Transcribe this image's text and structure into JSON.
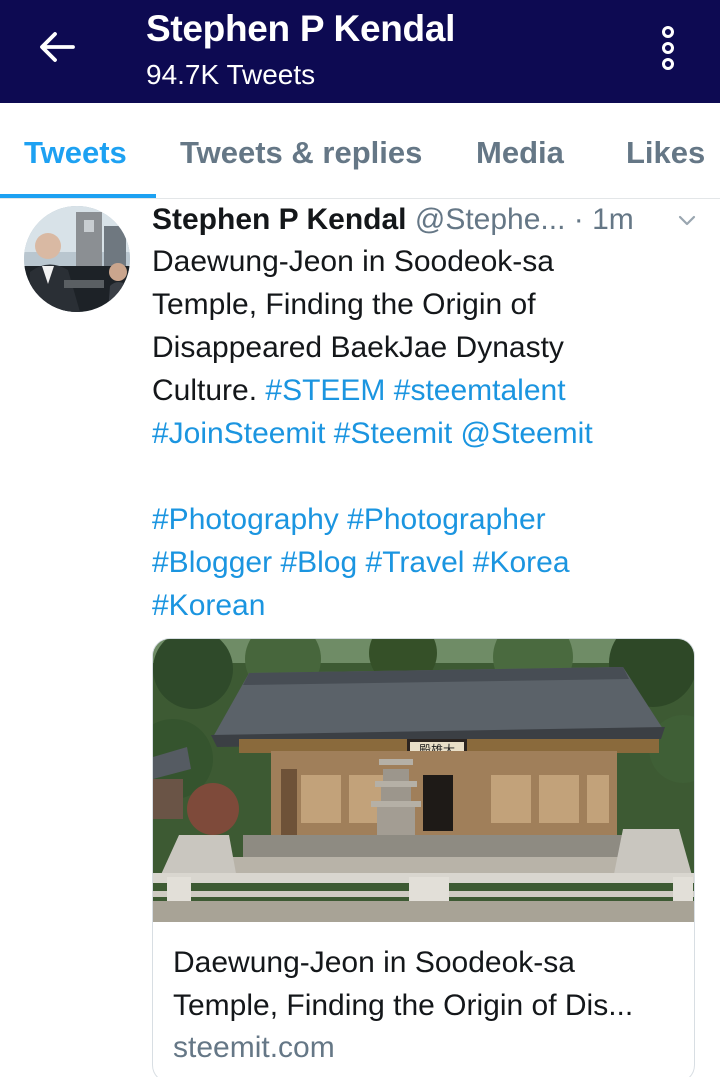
{
  "header": {
    "title": "Stephen P Kendal",
    "subtitle": "94.7K Tweets"
  },
  "tabs": [
    {
      "label": "Tweets",
      "active": true
    },
    {
      "label": "Tweets & replies",
      "active": false
    },
    {
      "label": "Media",
      "active": false
    },
    {
      "label": "Likes",
      "active": false
    }
  ],
  "tweet": {
    "author_name": "Stephen P Kendal",
    "author_handle": "@Stephe...",
    "separator": "·",
    "time": "1m",
    "text": {
      "line1": "Daewung-Jeon in Soodeok-sa",
      "line2": "Temple, Finding the Origin of",
      "line3": "Disappeared BaekJae Dynasty",
      "line4_text": "Culture. ",
      "line4_tag1": "#STEEM",
      "line4_tag2": "#steemtalent",
      "line5_tag1": "#JoinSteemit",
      "line5_tag2": "#Steemit",
      "line5_mention": "@Steemit",
      "line6_tag1": "#Photography",
      "line6_tag2": "#Photographer",
      "line7_tag1": "#Blogger",
      "line7_tag2": "#Blog",
      "line7_tag3": "#Travel",
      "line7_tag4": "#Korea",
      "line8_tag1": "#Korean"
    },
    "card": {
      "title_line1": "Daewung-Jeon in Soodeok-sa",
      "title_line2": "Temple, Finding the Origin of Dis...",
      "domain": "steemit.com",
      "signboard": "殿雄大"
    }
  },
  "colors": {
    "header_bg": "#0d0a52",
    "accent": "#1da1f2",
    "link": "#1b95e0",
    "muted": "#657786"
  },
  "icons": {
    "back": "arrow-left-icon",
    "more": "more-vertical-icon",
    "caret": "chevron-down-icon"
  }
}
